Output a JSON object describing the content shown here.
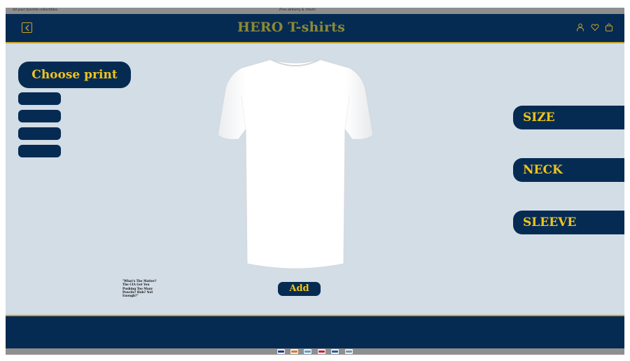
{
  "top_bar": {
    "promo_left": "All your favorite collectibles",
    "promo_center": "Free delivery & return"
  },
  "header": {
    "brand": "HERO T-shirts",
    "icons": [
      "back-arrow-icon",
      "user-icon",
      "heart-icon",
      "shopping-bag-icon"
    ]
  },
  "print_panel": {
    "title": "Choose print",
    "option_count": 4
  },
  "options": {
    "size": "SIZE",
    "neck": "NECK",
    "sleeve": "SLEEVE"
  },
  "product": {
    "image": "white t-shirt",
    "quote": "\"What's The Matter? The CIA Got You Pushing Too Many Pencils? Huh? Not Enough?\"",
    "add_label": "Add"
  },
  "footer": {
    "payment_methods": [
      "visa",
      "mastercard",
      "amex",
      "maestro",
      "paypal",
      "card"
    ]
  },
  "colors": {
    "navy": "#062b53",
    "gold": "#f0c419",
    "brand_olive": "#8c8a36",
    "background": "#d3dde6",
    "bar_gray": "#8f8f8f"
  }
}
